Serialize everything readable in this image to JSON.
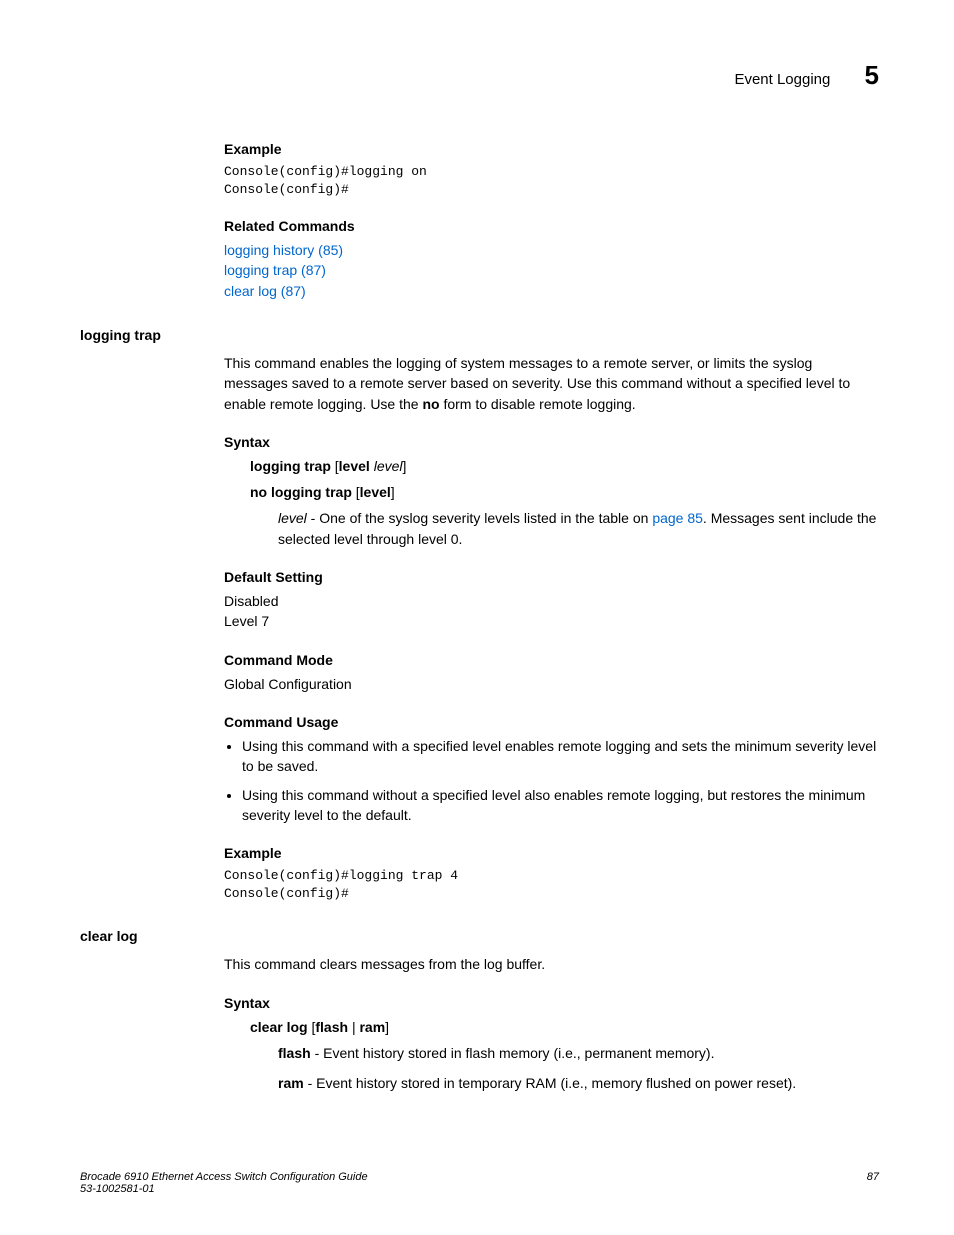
{
  "header": {
    "title": "Event Logging",
    "chapter": "5"
  },
  "sec1": {
    "example_h": "Example",
    "example_code": "Console(config)#logging on\nConsole(config)#",
    "related_h": "Related Commands",
    "link1": "logging history (85)",
    "link2": "logging trap (87)",
    "link3": "clear log (87)"
  },
  "logging_trap": {
    "title": "logging trap",
    "intro_a": "This command enables the logging of system messages to a remote server, or limits the syslog messages saved to a remote server based on severity. Use this command without a specified level to enable remote logging. Use the ",
    "intro_no": "no",
    "intro_b": " form to disable remote logging.",
    "syntax_h": "Syntax",
    "syn1a": "logging trap",
    "syn1b": " [",
    "syn1c": "level",
    "syn1d": " ",
    "syn1e": "level",
    "syn1f": "]",
    "syn2a": "no logging trap",
    "syn2b": " [",
    "syn2c": "level",
    "syn2d": "]",
    "level_a": "level",
    "level_b": " - One of the syslog severity levels listed in the table on ",
    "level_link": "page 85",
    "level_c": ". Messages sent include the selected level through level 0.",
    "default_h": "Default Setting",
    "default_1": "Disabled",
    "default_2": "Level 7",
    "mode_h": "Command Mode",
    "mode_v": "Global Configuration",
    "usage_h": "Command Usage",
    "usage_1": "Using this command with a specified level enables remote logging and sets the minimum severity level to be saved.",
    "usage_2": "Using this command without a specified level also enables remote logging, but restores the minimum severity level to the default.",
    "example_h": "Example",
    "example_code": "Console(config)#logging trap 4\nConsole(config)#"
  },
  "clear_log": {
    "title": "clear log",
    "intro": "This command clears messages from the log buffer.",
    "syntax_h": "Syntax",
    "syn_a": "clear log",
    "syn_b": " [",
    "syn_c": "flash",
    "syn_d": " | ",
    "syn_e": "ram",
    "syn_f": "]",
    "flash_a": "flash",
    "flash_b": " - Event history stored in flash memory (i.e., permanent memory).",
    "ram_a": "ram",
    "ram_b": " - Event history stored in temporary RAM (i.e., memory flushed on power reset)."
  },
  "footer": {
    "line1": "Brocade 6910 Ethernet Access Switch Configuration Guide",
    "line2": "53-1002581-01",
    "page": "87"
  }
}
